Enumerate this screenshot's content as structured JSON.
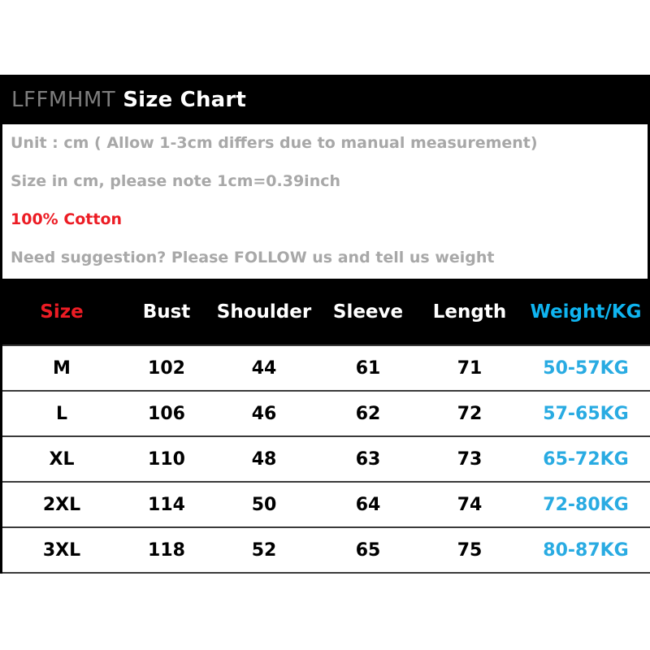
{
  "header": {
    "brand": "LFFMHMT",
    "title": "Size Chart"
  },
  "info": {
    "line1": "Unit : cm ( Allow 1-3cm differs due to manual measurement)",
    "line2": "Size in cm, please note 1cm=0.39inch",
    "line3": "100% Cotton",
    "line4": "Need suggestion? Please FOLLOW us and tell us weight"
  },
  "colors": {
    "accent_red": "#ec1c24",
    "accent_cyan": "#0fb4f0",
    "body_cyan": "#29abe2",
    "brand_gray": "#7d7d7d",
    "info_gray": "#a8a8a8",
    "band_black": "#000000"
  },
  "table": {
    "columns": [
      "Size",
      "Bust",
      "Shoulder",
      "Sleeve",
      "Length",
      "Weight/KG"
    ],
    "rows": [
      {
        "size": "M",
        "bust": "102",
        "shoulder": "44",
        "sleeve": "61",
        "length": "71",
        "weight": "50-57KG"
      },
      {
        "size": "L",
        "bust": "106",
        "shoulder": "46",
        "sleeve": "62",
        "length": "72",
        "weight": "57-65KG"
      },
      {
        "size": "XL",
        "bust": "110",
        "shoulder": "48",
        "sleeve": "63",
        "length": "73",
        "weight": "65-72KG"
      },
      {
        "size": "2XL",
        "bust": "114",
        "shoulder": "50",
        "sleeve": "64",
        "length": "74",
        "weight": "72-80KG"
      },
      {
        "size": "3XL",
        "bust": "118",
        "shoulder": "52",
        "sleeve": "65",
        "length": "75",
        "weight": "80-87KG"
      }
    ]
  }
}
